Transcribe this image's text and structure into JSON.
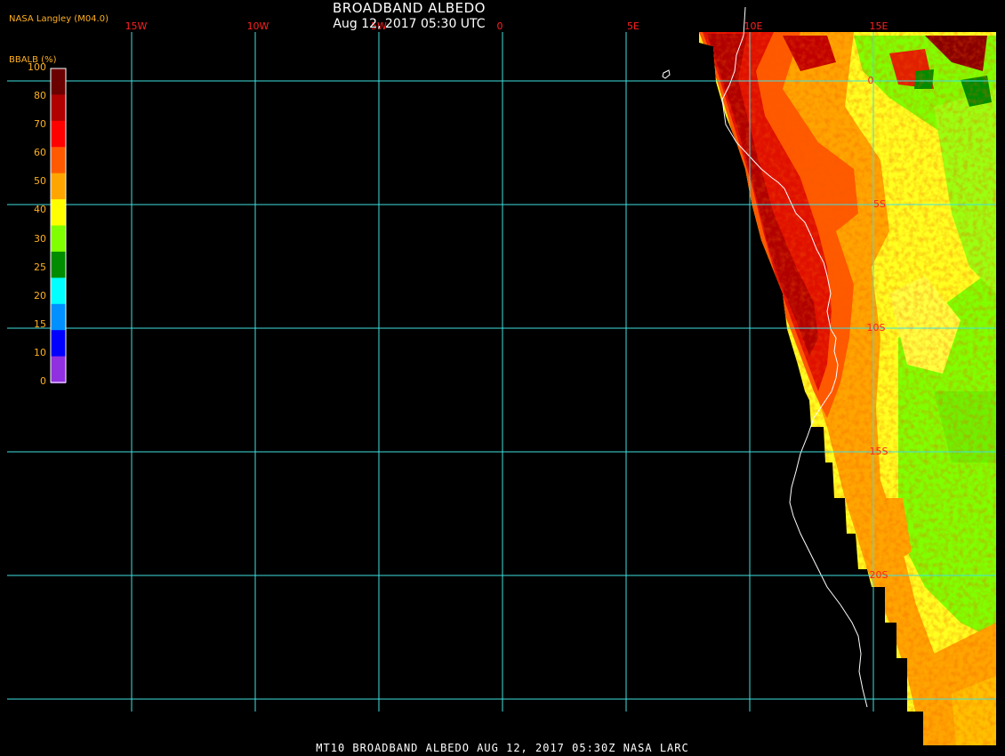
{
  "header": {
    "title": "BROADBAND ALBEDO",
    "datetime": "Aug 12, 2017 05:30 UTC",
    "producer": "NASA Langley (M04.0)"
  },
  "footer": {
    "caption": "MT10  BROADBAND ALBEDO   AUG 12, 2017 05:30Z   NASA LARC"
  },
  "legend": {
    "title": "BBALB (%)",
    "ticks": [
      "100",
      "80",
      "70",
      "60",
      "50",
      "40",
      "30",
      "25",
      "20",
      "15",
      "10",
      "0"
    ],
    "colors": [
      "#6b0000",
      "#b00000",
      "#ff0000",
      "#ff5a00",
      "#ffa500",
      "#ffff00",
      "#80ff00",
      "#008c00",
      "#00ffff",
      "#0090ff",
      "#0000ff",
      "#9030e0"
    ]
  },
  "grid": {
    "longitude_labels": [
      "15W",
      "10W",
      "5W",
      "0",
      "5E",
      "10E",
      "15E"
    ],
    "latitude_labels": [
      "0",
      "5S",
      "10S",
      "15S",
      "20S"
    ],
    "line_color": "#40e0e0",
    "label_color": "#ff2020"
  }
}
